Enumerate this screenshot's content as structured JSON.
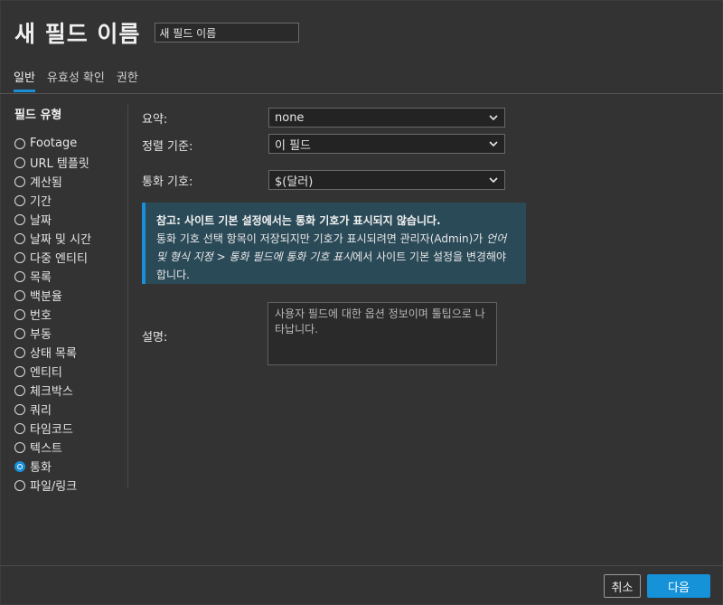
{
  "header": {
    "title": "새 필드 이름",
    "name_input_value": "새 필드 이름"
  },
  "tabs": [
    {
      "label": "일반",
      "active": true
    },
    {
      "label": "유효성 확인",
      "active": false
    },
    {
      "label": "권한",
      "active": false
    }
  ],
  "sidebar": {
    "title": "필드 유형",
    "items": [
      {
        "label": "Footage",
        "checked": false
      },
      {
        "label": "URL 템플릿",
        "checked": false
      },
      {
        "label": "계산됨",
        "checked": false
      },
      {
        "label": "기간",
        "checked": false
      },
      {
        "label": "날짜",
        "checked": false
      },
      {
        "label": "날짜 및 시간",
        "checked": false
      },
      {
        "label": "다중 엔티티",
        "checked": false
      },
      {
        "label": "목록",
        "checked": false
      },
      {
        "label": "백분율",
        "checked": false
      },
      {
        "label": "번호",
        "checked": false
      },
      {
        "label": "부동",
        "checked": false
      },
      {
        "label": "상태 목록",
        "checked": false
      },
      {
        "label": "엔티티",
        "checked": false
      },
      {
        "label": "체크박스",
        "checked": false
      },
      {
        "label": "쿼리",
        "checked": false
      },
      {
        "label": "타임코드",
        "checked": false
      },
      {
        "label": "텍스트",
        "checked": false
      },
      {
        "label": "통화",
        "checked": true
      },
      {
        "label": "파일/링크",
        "checked": false
      }
    ]
  },
  "form": {
    "summary_label": "요약:",
    "summary_value": "none",
    "sort_label": "정렬 기준:",
    "sort_value": "이 필드",
    "currency_label": "통화 기호:",
    "currency_value": "$(달러)",
    "description_label": "설명:",
    "description_placeholder": "사용자 필드에 대한 옵션 정보이며 툴팁으로 나타납니다."
  },
  "note": {
    "title": "참고: 사이트 기본 설정에서는 통화 기호가 표시되지 않습니다.",
    "body_start": "통화 기호 선택 항목이 저장되지만 기호가 표시되려면 관리자(Admin)가 ",
    "body_em": "언어 및 형식 지정 > 통화 필드에 통화 기호 표시",
    "body_end": "에서 사이트 기본 설정을 변경해야 합니다."
  },
  "footer": {
    "cancel_label": "취소",
    "next_label": "다음"
  },
  "colors": {
    "accent": "#1a8fd6",
    "background": "#333333",
    "note_background": "#2b4a58"
  }
}
